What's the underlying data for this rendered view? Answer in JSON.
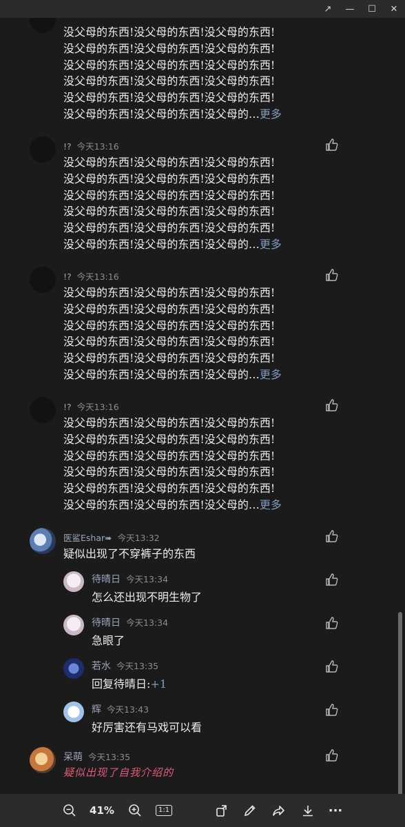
{
  "window": {
    "minimize": "—",
    "maximize": "☐",
    "close": "✕",
    "pin": "↗"
  },
  "comments": [
    {
      "text": "没父母的东西!没父母的东西!没父母的东西!\n没父母的东西!没父母的东西!没父母的东西!\n没父母的东西!没父母的东西!没父母的东西!\n没父母的东西!没父母的东西!没父母的东西!\n没父母的东西!没父母的东西!没父母的东西!\n没父母的东西!没父母的东西!没父母的…",
      "more": "更多"
    },
    {
      "name": "!?",
      "time": "今天13:16",
      "text": "没父母的东西!没父母的东西!没父母的东西!\n没父母的东西!没父母的东西!没父母的东西!\n没父母的东西!没父母的东西!没父母的东西!\n没父母的东西!没父母的东西!没父母的东西!\n没父母的东西!没父母的东西!没父母的东西!\n没父母的东西!没父母的东西!没父母的…",
      "more": "更多"
    },
    {
      "name": "!?",
      "time": "今天13:16",
      "text": "没父母的东西!没父母的东西!没父母的东西!\n没父母的东西!没父母的东西!没父母的东西!\n没父母的东西!没父母的东西!没父母的东西!\n没父母的东西!没父母的东西!没父母的东西!\n没父母的东西!没父母的东西!没父母的东西!\n没父母的东西!没父母的东西!没父母的…",
      "more": "更多"
    },
    {
      "name": "!?",
      "time": "今天13:16",
      "text": "没父母的东西!没父母的东西!没父母的东西!\n没父母的东西!没父母的东西!没父母的东西!\n没父母的东西!没父母的东西!没父母的东西!\n没父母的东西!没父母的东西!没父母的东西!\n没父母的东西!没父母的东西!没父母的东西!\n没父母的东西!没父母的东西!没父母的…",
      "more": "更多"
    },
    {
      "name": "医鲨Eshar➠",
      "time": "今天13:32",
      "text": "疑似出现了不穿裤子的东西"
    }
  ],
  "replies": [
    {
      "name": "待晴日",
      "time": "今天13:34",
      "text": "怎么还出现不明生物了"
    },
    {
      "name": "待晴日",
      "time": "今天13:34",
      "text": "急眼了"
    },
    {
      "name": "若水",
      "time": "今天13:35",
      "text": "回复待晴日:",
      "plus": "+1"
    },
    {
      "name": "辉",
      "time": "今天13:43",
      "text": "好厉害还有马戏可以看"
    }
  ],
  "last": {
    "name": "呆萌",
    "time": "今天13:35",
    "text": "疑似出现了自我介绍的"
  },
  "toolbar": {
    "zoom": "41%",
    "ratio": "1:1",
    "more": "···"
  },
  "colors": {
    "background": "#1b1b1b",
    "chrome": "#2b2b2b",
    "link": "#7f9bbd",
    "signature": "#e05a78"
  }
}
